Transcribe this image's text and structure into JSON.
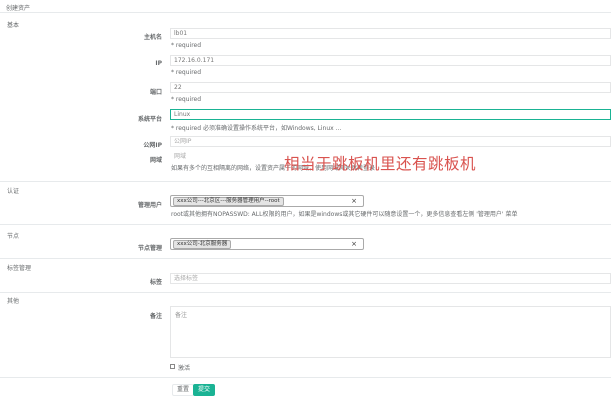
{
  "page": {
    "title": "创建资产"
  },
  "sections": {
    "basic": "基本",
    "auth": "认证",
    "node": "节点",
    "labels": "标签管理",
    "other": "其他"
  },
  "fields": {
    "hostname": {
      "label": "主机名",
      "value": "lb01",
      "help": "* required"
    },
    "ip": {
      "label": "IP",
      "value": "172.16.0.171",
      "help": "* required"
    },
    "port": {
      "label": "端口",
      "value": "22",
      "help": "* required"
    },
    "platform": {
      "label": "系统平台",
      "value": "Linux",
      "help": "* required 必须准确设置操作系统平台，如Windows, Linux ..."
    },
    "public_ip": {
      "label": "公网IP",
      "placeholder": "公网IP"
    },
    "domain": {
      "label": "网域",
      "placeholder": "网域",
      "help": "如果有多个的互相隔离的网络，设置资产属于的网域，使用网域网关跳转登录"
    },
    "admin_user": {
      "label": "管理用户",
      "tag": "xxx公司---北京区---服务器管理用户--root",
      "remove": "×",
      "help": "root或其他拥有NOPASSWD: ALL权限的用户，如果是windows或其它硬件可以随意设置一个，更多信息查看左侧 '管理用户' 菜单"
    },
    "nodes": {
      "label": "节点管理",
      "tag": "xxx公司-北京服务器",
      "remove": "×"
    },
    "tags": {
      "label": "标签",
      "placeholder": "选择标签"
    },
    "comment": {
      "label": "备注",
      "placeholder": "备注"
    },
    "active": {
      "label": "激活"
    }
  },
  "watermark": "相当于跳板机里还有跳板机",
  "buttons": {
    "reset": "重置",
    "submit": "提交"
  },
  "colors": {
    "accent": "#1ab394",
    "watermark": "#d9534f"
  }
}
